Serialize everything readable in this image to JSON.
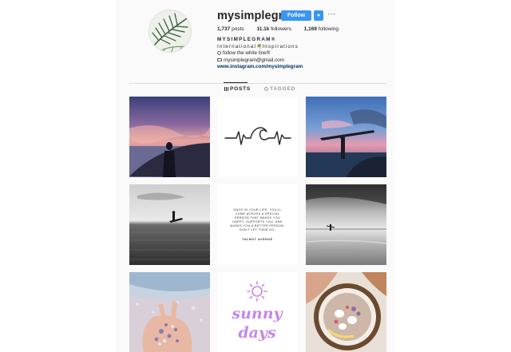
{
  "profile": {
    "username": "mysimplegram",
    "follow_label": "Follow",
    "more_label": "···",
    "stats": {
      "posts_value": "1,737",
      "posts_label": "posts",
      "followers_value": "11.1k",
      "followers_label": "followers",
      "following_value": "1,169",
      "following_label": "following"
    },
    "bio": {
      "full_name": "MYSIMPLEGRAM®",
      "line1": "International",
      "palm_emoji": "🌴",
      "line1b": "Inspirations",
      "line2": "follow the white line®",
      "line3": "mysimplegram@gmail.com",
      "website": "www.instagram.com/mysimplegram"
    }
  },
  "tabs": [
    {
      "label": "POSTS",
      "icon": "grid-icon",
      "active": true
    },
    {
      "label": "TAGGED",
      "icon": "tag-icon",
      "active": false
    }
  ],
  "grid": [
    {
      "name": "sunset-surfer-silhouette",
      "type": "photo"
    },
    {
      "name": "heartbeat-wave-line",
      "type": "graphic"
    },
    {
      "name": "surfer-board-overhead",
      "type": "photo"
    },
    {
      "name": "surfer-paddling-bw",
      "type": "photo"
    },
    {
      "name": "quote-card",
      "type": "text",
      "quote": "ONCE IN YOUR LIFE, YOU'LL COME ACROSS A SPECIAL PERSON THAT MAKES YOU HAPPY, SUPPORTS YOU, AND MAKES YOU A BETTER PERSON. DON'T LET THEM GO.",
      "author": "TALBOT AVENUE"
    },
    {
      "name": "surfer-walking-bw",
      "type": "photo"
    },
    {
      "name": "shells-in-hand",
      "type": "photo"
    },
    {
      "name": "sunny-days",
      "type": "graphic",
      "line1": "sunny",
      "line2": "days"
    },
    {
      "name": "coconut-bowl",
      "type": "photo"
    }
  ],
  "colors": {
    "follow_blue": "#3897f0",
    "link_blue": "#003569",
    "sunny_purple": "#c587e8"
  }
}
